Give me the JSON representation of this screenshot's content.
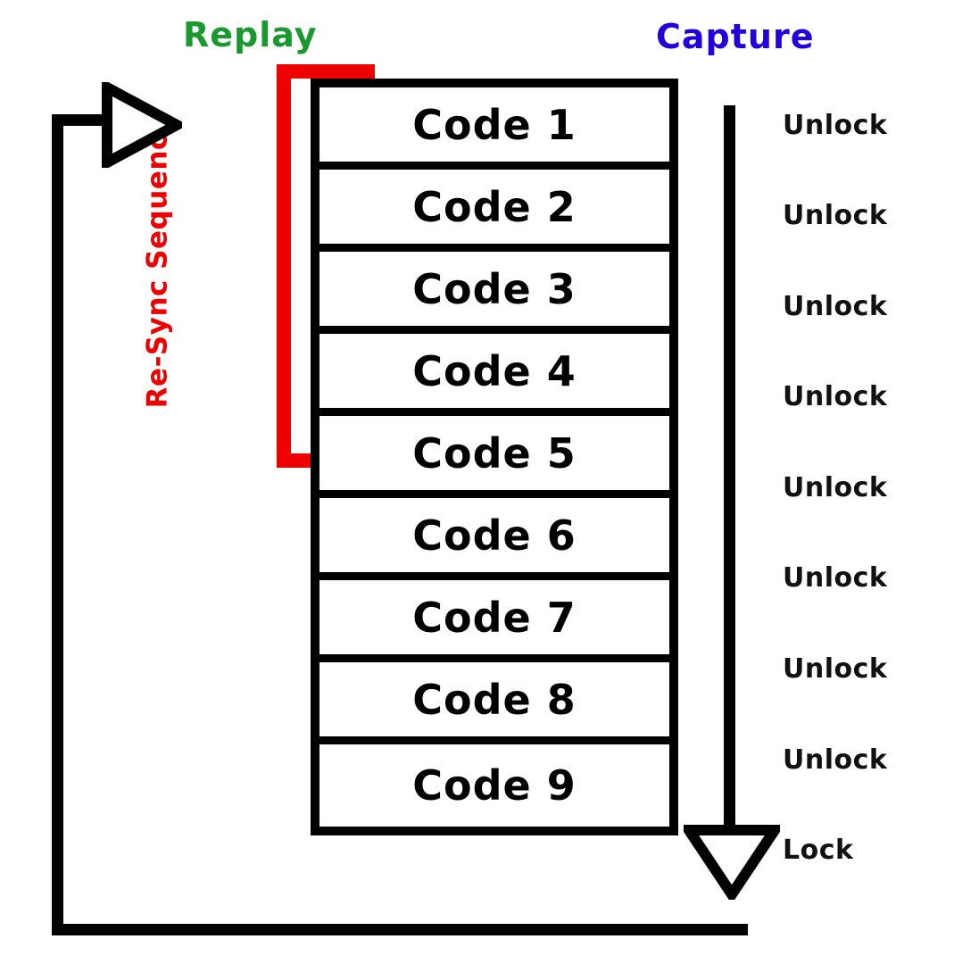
{
  "diagram": {
    "title_replay": "Replay",
    "title_capture": "Capture",
    "resync_label": "Re-Sync Sequence",
    "colors": {
      "replay": "#1a9a2e",
      "capture": "#2200dd",
      "resync": "#ee0000",
      "stroke": "#000000",
      "background": "#ffffff"
    }
  },
  "codes": [
    {
      "label": "Code 1",
      "status": "Unlock"
    },
    {
      "label": "Code 2",
      "status": "Unlock"
    },
    {
      "label": "Code 3",
      "status": "Unlock"
    },
    {
      "label": "Code 4",
      "status": "Unlock"
    },
    {
      "label": "Code 5",
      "status": "Unlock"
    },
    {
      "label": "Code 6",
      "status": "Unlock"
    },
    {
      "label": "Code 7",
      "status": "Unlock"
    },
    {
      "label": "Code 8",
      "status": "Unlock"
    },
    {
      "label": "Code 9",
      "status": "Lock"
    }
  ],
  "icons": {
    "replay_arrow": "play-triangle-right-icon",
    "lock_arrow": "triangle-down-icon"
  }
}
